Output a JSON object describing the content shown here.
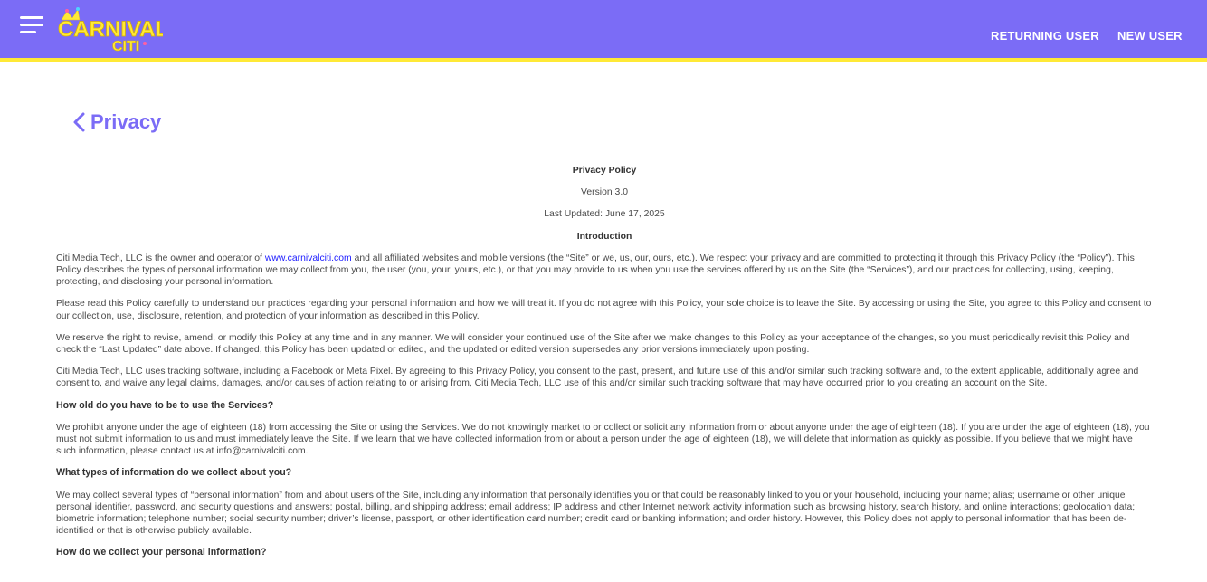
{
  "header": {
    "logo_text_top": "CARNIVAL",
    "logo_text_bottom": "CITI",
    "returning_user": "RETURNING USER",
    "new_user": "NEW USER"
  },
  "page": {
    "title": "Privacy"
  },
  "doc": {
    "heading": "Privacy Policy",
    "version": "Version 3.0",
    "updated": "Last Updated: June 17, 2025",
    "intro_heading": "Introduction",
    "p1_a": "Citi Media Tech, LLC is the owner and operator of",
    "p1_link": " www.carnivalciti.com",
    "p1_b": " and all affiliated websites and mobile versions (the “Site” or we, us, our, ours, etc.). We respect your privacy and are committed to protecting it through this Privacy Policy (the “Policy”). This Policy describes the types of personal information we may collect from you, the user (you, your, yours, etc.), or that you may provide to us when you use the services offered by us on the Site (the “Services”), and our practices for collecting, using, keeping, protecting, and disclosing your personal information.",
    "p2": "Please read this Policy carefully to understand our practices regarding your personal information and how we will treat it. If you do not agree with this Policy, your sole choice is to leave the Site. By accessing or using the Site, you agree to this Policy and consent to our collection, use, disclosure, retention, and protection of your information as described in this Policy.",
    "p3": "We reserve the right to revise, amend, or modify this Policy at any time and in any manner. We will consider your continued use of the Site after we make changes to this Policy as your acceptance of the changes, so you must periodically revisit this Policy and check the “Last Updated” date above. If changed, this Policy has been updated or edited, and the updated or edited version supersedes any prior versions immediately upon posting.",
    "p4": "Citi Media Tech, LLC uses tracking software, including a Facebook or Meta Pixel. By agreeing to this Privacy Policy, you consent to the past, present, and future use of this and/or similar such tracking software and, to the extent applicable, additionally agree and consent to, and waive any legal claims, damages, and/or causes of action relating to or arising from, Citi Media Tech, LLC use of this and/or similar such tracking software that may have occurred prior to you creating an account on the Site.",
    "h_age": "How old do you have to be to use the Services?",
    "p_age": "We prohibit anyone under the age of eighteen (18) from accessing the Site or using the Services. We do not knowingly market to or collect or solicit any information from or about anyone under the age of eighteen (18). If you are under the age of eighteen (18), you must not submit information to us and must immediately leave the Site. If we learn that we have collected information from or about a person under the age of eighteen (18), we will delete that information as quickly as possible. If you believe that we might have such information, please contact us at info@carnivalciti.com.",
    "h_types": "What types of information do we collect about you?",
    "p_types": "We may collect several types of “personal information” from and about users of the Site, including any information that personally identifies you or that could be reasonably linked to you or your household, including your name; alias; username or other unique personal identifier, password, and security questions and answers; postal, billing, and shipping address; email address; IP address and other Internet network activity information such as browsing history, search history, and online interactions; geolocation data; biometric information; telephone number; social security number; driver’s license, passport, or other identification card number; credit card or banking information; and order history. However, this Policy does not apply to personal information that has been de-identified or that is otherwise publicly available.",
    "h_collect": "How do we collect your personal information?"
  },
  "colors": {
    "brand": "#7b6cf6",
    "accent": "#ffe936"
  }
}
